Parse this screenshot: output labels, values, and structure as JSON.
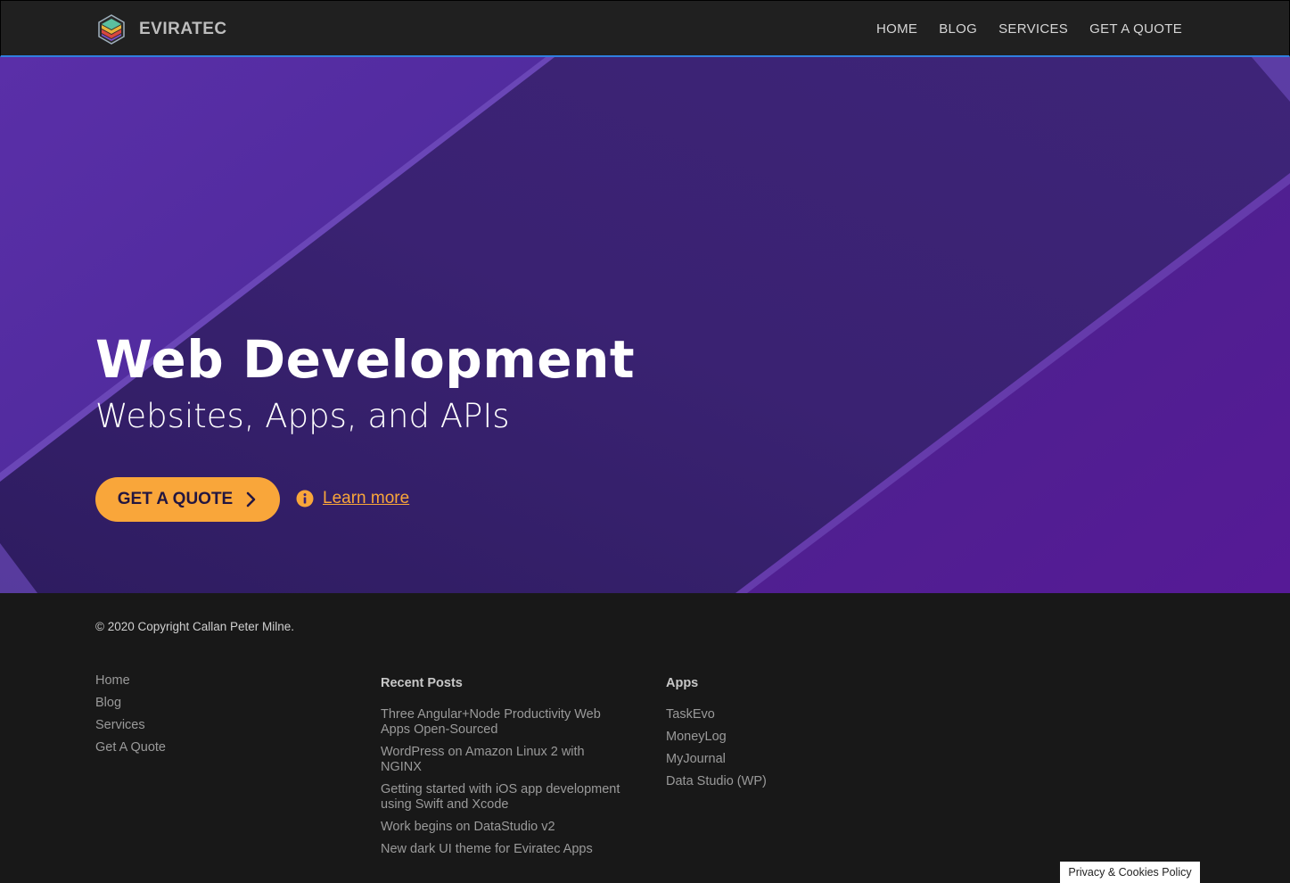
{
  "header": {
    "logo_text": "EVIRATEC",
    "nav": [
      "HOME",
      "BLOG",
      "SERVICES",
      "GET A QUOTE"
    ]
  },
  "hero": {
    "title": "Web Development",
    "subtitle": "Websites, Apps, and APIs",
    "cta_label": "GET A QUOTE",
    "learn_more": "Learn more"
  },
  "footer": {
    "copyright": "© 2020 Copyright Callan Peter Milne.",
    "links": [
      "Home",
      "Blog",
      "Services",
      "Get A Quote"
    ],
    "recent_posts": {
      "heading": "Recent Posts",
      "items": [
        "Three Angular+Node Productivity Web Apps Open-Sourced",
        "WordPress on Amazon Linux 2 with NGINX",
        "Getting started with iOS app development using Swift and Xcode",
        "Work begins on DataStudio v2",
        "New dark UI theme for Eviratec Apps"
      ]
    },
    "apps": {
      "heading": "Apps",
      "items": [
        "TaskEvo",
        "MoneyLog",
        "MyJournal",
        "Data Studio (WP)"
      ]
    },
    "privacy": "Privacy & Cookies Policy"
  },
  "colors": {
    "accent": "#f9a63a",
    "hero_purple": "#3b2275",
    "header_border": "#2f7fe0",
    "footer_bg": "#181818"
  },
  "icons": [
    "logo-icon",
    "chevron-right-icon",
    "info-icon"
  ]
}
